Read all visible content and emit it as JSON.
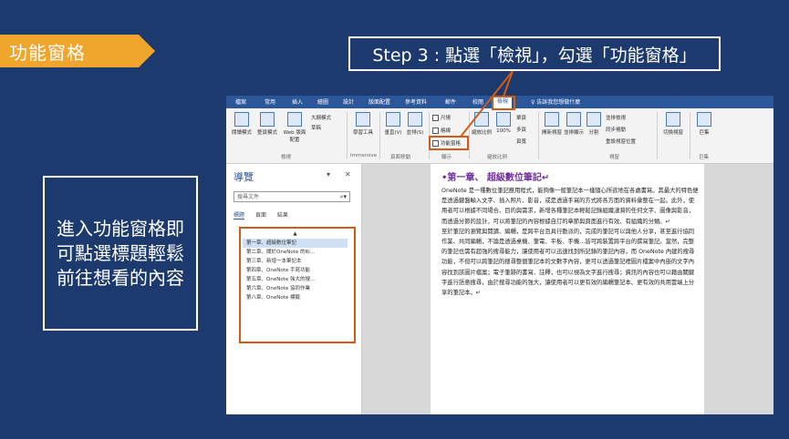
{
  "slide": {
    "title": "功能窗格",
    "step_text": "Step 3 : 點選「檢視」，勾選「功能窗格」",
    "caption": "進入功能窗格即可點選標題輕鬆前往想看的內容"
  },
  "colors": {
    "background": "#1c3a6e",
    "title_bar": "#f0a52c",
    "highlight": "#d25b16",
    "ribbon_blue": "#2b579a"
  },
  "word": {
    "menu_tabs": [
      "檔案",
      "常用",
      "插入",
      "繪圖",
      "設計",
      "版面配置",
      "參考資料",
      "郵件",
      "校閱",
      "檢視"
    ],
    "active_tab": "檢視",
    "tell_me": "♀ 告訴我您想做什麼",
    "ribbon": {
      "read_mode": "閱讀模式",
      "print_layout": "整頁模式",
      "web_layout": "Web 版面配置",
      "outline": "大綱模式",
      "draft": "草稿",
      "views_group": "檢視",
      "learning_tools": "學習工具",
      "immersive_group": "Immersive",
      "vertical": "垂直(V)",
      "side_by_side": "並排(S)",
      "page_move_group": "頁面移動",
      "ruler": "尺規",
      "gridlines": "格線",
      "nav_pane": "功能窗格",
      "show_group": "顯示",
      "zoom": "縮放比例",
      "zoom_100": "100%",
      "one_page": "單頁",
      "multi_page": "多頁",
      "page_width": "頁寬",
      "zoom_group": "縮放比例",
      "new_window": "開新視窗",
      "arrange_all": "並排顯示",
      "split": "分割",
      "side_by_side_view": "並排檢視",
      "sync_scroll": "同步捲動",
      "reset_position": "重設視窗位置",
      "window_group": "視窗",
      "switch_windows": "切換視窗",
      "macros": "巨集",
      "macros_group": "巨集"
    },
    "nav": {
      "title": "導覽",
      "search_placeholder": "搜尋文件",
      "tabs": [
        "標題",
        "頁面",
        "結果"
      ],
      "items": [
        "▲",
        "第一章、超級數位筆記",
        "第二章、關於OneNote 的Ri...",
        "第三章、新增一本筆記本",
        "第四章、OneNote 手寫功能",
        "第五章、OneNote 強大的搜...",
        "第六章、OneNote 協同作業",
        "第八章、OneNote 標籤"
      ]
    },
    "doc": {
      "heading": "•第一章、 超級數位筆記↵",
      "paragraphs": [
        "OneNote 是一種數位筆記應用程式，能夠像一般筆記本一樣隨心所欲地在各處書寫。其最大的特色便是透過鍵盤輸入文字、插入照片、影音，或是透過手寫的方式將各方面的資料彙整在一起。此外，使用者可以根據不同場合、目的與需求，新增各種筆記本輕鬆記錄組織漣漪的任何文字、圖像與影音，而透過分節的設計，可以將筆記的內容根據自訂的章節與頁面進行有效、有組織的分類。↵",
        "至於筆記的瀏覽與閱讀、編輯，是跨平台且具行動派的，完成的筆記可以與他人分享，甚至進行協同作業、共同編輯，不論是透過桌機、筆電、平板、手機…皆可跨裝置跨平台的撰寫筆記。當然，完整的筆記也需有超強的搜尋能力，讓使用者可以迅速找到所記錄的筆記內容，而 OneNote 內建的搜尋功能，不但可以跨筆記的搜尋整個筆記本的文數字內容，更可以透過筆記裡圖片檔案中內嵌的文字內容找到該圖片檔案；電子筆跡的書寫、註釋，也可以視為文字進行搜尋；資訊的內容也可以藉由關鍵字進行語意搜尋，由於搜尋功能的強大，讓使用者可以更有效的編輯筆記本、更有效的共用雲端上分享的筆記本。↵"
      ]
    }
  }
}
